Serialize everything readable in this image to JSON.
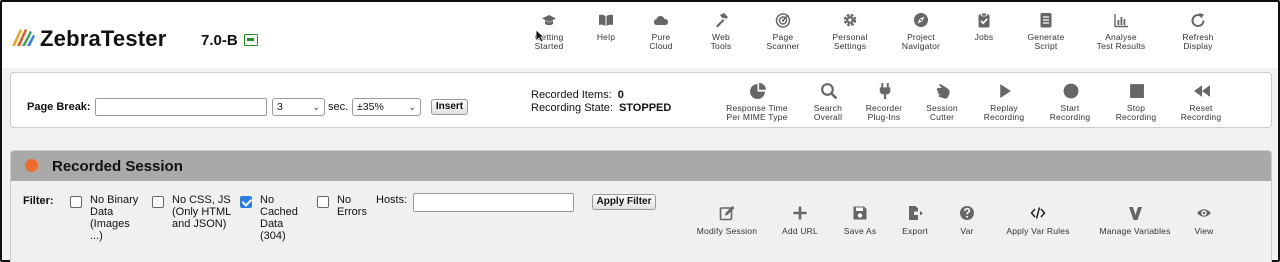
{
  "header": {
    "brand": "ZebraTester",
    "version": "7.0-B",
    "nav": [
      {
        "label": "Getting\nStarted",
        "icon": "graduation-cap-icon"
      },
      {
        "label": "Help",
        "icon": "book-icon"
      },
      {
        "label": "Pure\nCloud",
        "icon": "cloud-icon"
      },
      {
        "label": "Web\nTools",
        "icon": "hammer-icon"
      },
      {
        "label": "Page\nScanner",
        "icon": "radar-icon"
      },
      {
        "label": "Personal\nSettings",
        "icon": "gear-icon"
      },
      {
        "label": "Project\nNavigator",
        "icon": "compass-icon"
      },
      {
        "label": "Jobs",
        "icon": "clipboard-check-icon"
      },
      {
        "label": "Generate\nScript",
        "icon": "script-icon"
      },
      {
        "label": "Analyse\nTest Results",
        "icon": "bar-chart-icon"
      },
      {
        "label": "Refresh\nDisplay",
        "icon": "refresh-icon"
      }
    ]
  },
  "recorder": {
    "page_break_label": "Page Break:",
    "page_break_value": "",
    "seconds_value": "3",
    "sec_label": "sec.",
    "tolerance_value": "±35%",
    "insert_label": "Insert",
    "recorded_items_label": "Recorded Items:",
    "recorded_items_value": "0",
    "recording_state_label": "Recording State:",
    "recording_state_value": "STOPPED",
    "tools": [
      {
        "label": "Response Time\nPer MIME Type",
        "icon": "pie-chart-icon"
      },
      {
        "label": "Search\nOverall",
        "icon": "search-icon"
      },
      {
        "label": "Recorder\nPlug-Ins",
        "icon": "plug-icon"
      },
      {
        "label": "Session\nCutter",
        "icon": "hand-icon"
      },
      {
        "label": "Replay\nRecording",
        "icon": "play-icon"
      },
      {
        "label": "Start\nRecording",
        "icon": "record-icon"
      },
      {
        "label": "Stop\nRecording",
        "icon": "stop-icon"
      },
      {
        "label": "Reset\nRecording",
        "icon": "rewind-icon"
      }
    ]
  },
  "session": {
    "title": "Recorded Session",
    "filter_label": "Filter:",
    "filters": [
      {
        "label": "No Binary\nData\n(Images\n...)",
        "checked": false
      },
      {
        "label": "No CSS, JS\n(Only HTML\nand JSON)",
        "checked": false
      },
      {
        "label": "No\nCached\nData\n(304)",
        "checked": true
      },
      {
        "label": "No\nErrors",
        "checked": false
      }
    ],
    "hosts_label": "Hosts:",
    "hosts_value": "",
    "apply_filter_label": "Apply Filter",
    "tools": [
      {
        "label": "Modify Session",
        "icon": "edit-icon"
      },
      {
        "label": "Add URL",
        "icon": "plus-icon"
      },
      {
        "label": "Save As",
        "icon": "save-icon"
      },
      {
        "label": "Export",
        "icon": "export-icon"
      },
      {
        "label": "Var",
        "icon": "help-circle-icon"
      },
      {
        "label": "Apply Var Rules",
        "icon": "code-icon"
      },
      {
        "label": "Manage Variables",
        "icon": "variables-icon"
      },
      {
        "label": "View",
        "icon": "eye-icon"
      }
    ]
  },
  "colors": {
    "record_dot": "#f06a2a",
    "session_header": "#a9a9a9",
    "checkbox_checked": "#2b7de9",
    "icon_gray": "#666666"
  }
}
